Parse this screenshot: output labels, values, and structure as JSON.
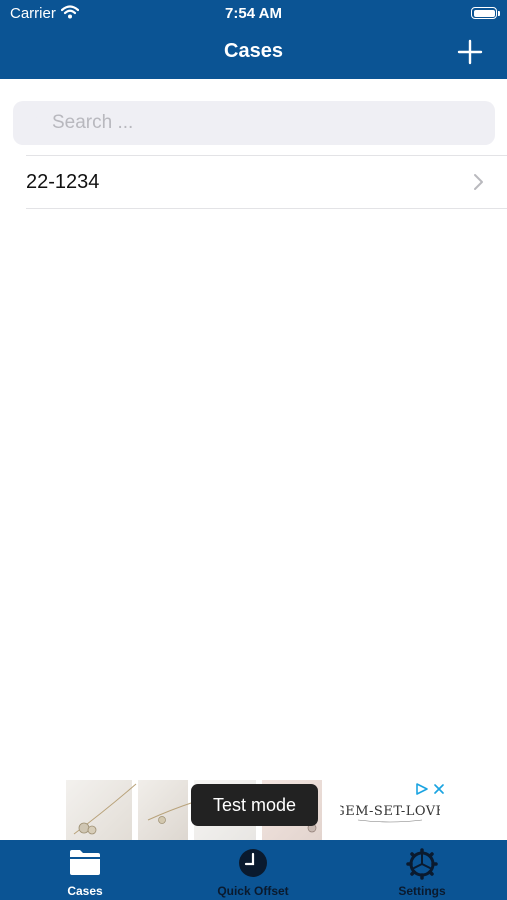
{
  "status_bar": {
    "carrier": "Carrier",
    "time": "7:54 AM"
  },
  "nav": {
    "title": "Cases",
    "add_icon": "plus-icon"
  },
  "search": {
    "placeholder": "Search ...",
    "value": ""
  },
  "cases": [
    {
      "label": "22-1234"
    }
  ],
  "ad": {
    "toast": "Test mode",
    "logo_text": "GEM-SET-LOVE"
  },
  "tabs": [
    {
      "label": "Cases",
      "icon": "folder-icon",
      "selected": true
    },
    {
      "label": "Quick Offset",
      "icon": "clock-icon",
      "selected": false
    },
    {
      "label": "Settings",
      "icon": "gear-icon",
      "selected": false
    }
  ],
  "colors": {
    "brand": "#0b5494",
    "tab_active": "#ffffff",
    "tab_inactive": "#0a1a2e"
  }
}
